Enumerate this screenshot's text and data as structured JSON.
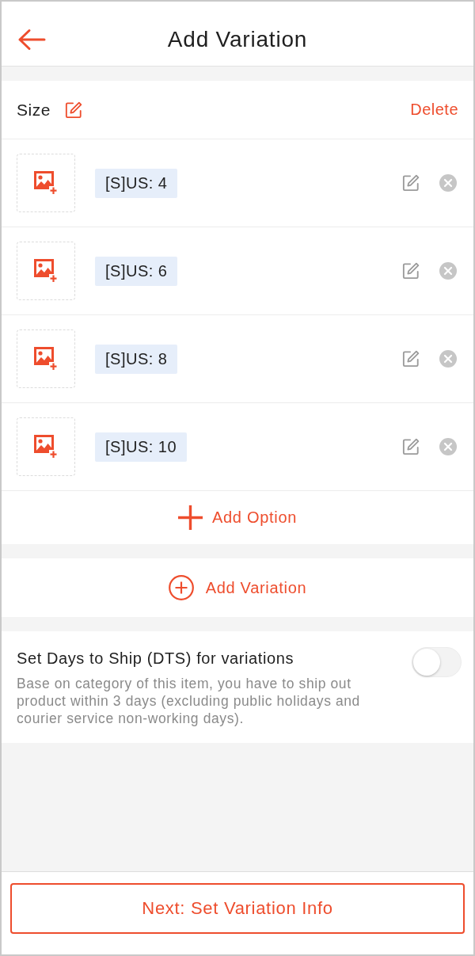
{
  "header": {
    "title": "Add Variation"
  },
  "variation": {
    "name": "Size",
    "delete_label": "Delete",
    "options": [
      {
        "label": "[S]US: 4"
      },
      {
        "label": "[S]US: 6"
      },
      {
        "label": "[S]US: 8"
      },
      {
        "label": "[S]US: 10"
      }
    ],
    "add_option_label": "Add Option"
  },
  "add_variation_label": "Add Variation",
  "dts": {
    "title": "Set Days to Ship (DTS) for variations",
    "description": "Base on category of this item, you have to ship out product within 3 days (excluding public holidays and courier service non-working days).",
    "on": false
  },
  "footer_button": "Next: Set Variation Info"
}
